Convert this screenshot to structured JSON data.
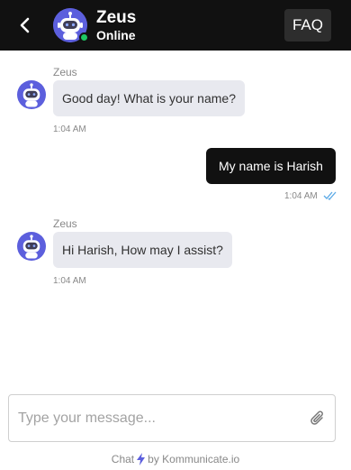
{
  "header": {
    "agent_name": "Zeus",
    "agent_status": "Online",
    "faq_label": "FAQ"
  },
  "messages": [
    {
      "direction": "incoming",
      "sender": "Zeus",
      "text": "Good day! What is your name?",
      "time": "1:04 AM"
    },
    {
      "direction": "outgoing",
      "text": "My name is Harish",
      "time": "1:04 AM",
      "status": "read"
    },
    {
      "direction": "incoming",
      "sender": "Zeus",
      "text": "Hi Harish, How may I assist?",
      "time": "1:04 AM"
    }
  ],
  "composer": {
    "placeholder": "Type your message...",
    "value": ""
  },
  "footer": {
    "prefix": "Chat",
    "suffix": "by Kommunicate.io"
  },
  "colors": {
    "header_bg": "#111111",
    "brand_purple": "#5c5fdd",
    "online_green": "#1ec764",
    "bolt_purple": "#5c5fdd",
    "read_tick_blue": "#5aa9e6"
  }
}
